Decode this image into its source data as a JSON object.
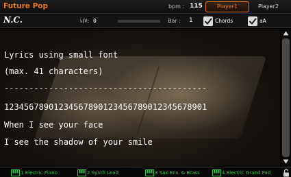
{
  "header": {
    "song_title": "Future Pop",
    "bpm_label": "bpm :",
    "bpm_value": "115",
    "tabs": [
      {
        "label": "Player1",
        "active": true
      },
      {
        "label": "Player2",
        "active": false
      }
    ]
  },
  "controls": {
    "chord": "N.C.",
    "transpose_label": "♭/♯:",
    "transpose_value": "0",
    "song_progress": 0.0,
    "bar_label": "Bar :",
    "bar_value": "1",
    "checkboxes": [
      {
        "label": "Chords",
        "checked": true
      },
      {
        "label": "aA",
        "checked": true
      }
    ]
  },
  "lyrics": {
    "lines": [
      "Lyrics using small font",
      "(max. 41 characters)",
      "-----------------------------------------",
      "12345678901234567890123456789012345678901",
      "When I see your face",
      "I see the shadow of your smile"
    ]
  },
  "keyboard_sounds": [
    {
      "number": "1",
      "name": "Electric Piano"
    },
    {
      "number": "2",
      "name": "Synth Lead"
    },
    {
      "number": "3",
      "name": "Sax Ens. & Brass"
    },
    {
      "number": "4",
      "name": "Electric Grand Pad"
    }
  ],
  "colors": {
    "accent": "#ee7a1c",
    "sound_green": "#33c94a",
    "text": "#ffffff"
  },
  "icons": [
    "checkmark-icon",
    "scroll-up-icon",
    "scroll-down-icon",
    "keyboard-icon",
    "lock-icon"
  ]
}
